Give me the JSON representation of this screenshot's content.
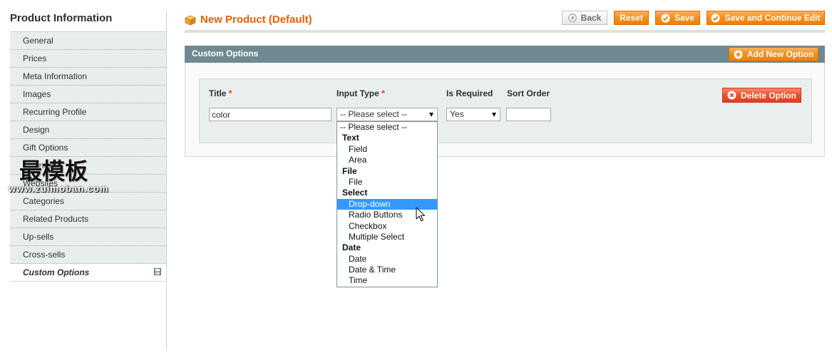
{
  "sidebar": {
    "title": "Product Information",
    "tabs": [
      {
        "label": "General"
      },
      {
        "label": "Prices"
      },
      {
        "label": "Meta Information"
      },
      {
        "label": "Images"
      },
      {
        "label": "Recurring Profile"
      },
      {
        "label": "Design"
      },
      {
        "label": "Gift Options"
      },
      {
        "label": "Inventory"
      },
      {
        "label": "Websites"
      },
      {
        "label": "Categories"
      },
      {
        "label": "Related Products"
      },
      {
        "label": "Up-sells"
      },
      {
        "label": "Cross-sells"
      },
      {
        "label": "Custom Options",
        "active": true
      }
    ]
  },
  "header": {
    "title": "New Product (Default)",
    "buttons": {
      "back": "Back",
      "reset": "Reset",
      "save": "Save",
      "save_and_continue": "Save and Continue Edit"
    }
  },
  "custom_options": {
    "section_title": "Custom Options",
    "add_button": "Add New Option",
    "option": {
      "labels": {
        "title": "Title",
        "input_type": "Input Type",
        "is_required": "Is Required",
        "sort_order": "Sort Order"
      },
      "required_mark": "*",
      "title_value": "color",
      "input_type_value": "-- Please select --",
      "is_required_value": "Yes",
      "sort_order_value": "",
      "delete_button": "Delete Option",
      "input_type_dropdown": {
        "open": true,
        "items": [
          {
            "label": "-- Please select --"
          },
          {
            "label": "Text",
            "group": true
          },
          {
            "label": "Field"
          },
          {
            "label": "Area"
          },
          {
            "label": "File",
            "group": true
          },
          {
            "label": "File"
          },
          {
            "label": "Select",
            "group": true
          },
          {
            "label": "Drop-down",
            "highlighted": true
          },
          {
            "label": "Radio Buttons"
          },
          {
            "label": "Checkbox"
          },
          {
            "label": "Multiple Select"
          },
          {
            "label": "Date",
            "group": true
          },
          {
            "label": "Date"
          },
          {
            "label": "Date & Time"
          },
          {
            "label": "Time"
          }
        ]
      }
    }
  },
  "watermark": {
    "logo_text": "最模板",
    "url": "www.zuimoban.com"
  },
  "icons": {
    "page": "product-box-icon",
    "back": "back-arrow-icon",
    "save": "check-circle-icon",
    "add": "plus-circle-icon",
    "delete": "x-circle-icon",
    "tab_changed": "floppy-disk-icon",
    "pointer": "mouse-cursor-icon"
  },
  "colors": {
    "title_orange": "#eb5e00",
    "button_orange": "#f18200",
    "section_header": "#6f8992",
    "delete_red": "#ea4f2e",
    "required_red": "#eb340a",
    "option_highlight": "#3399ff"
  }
}
